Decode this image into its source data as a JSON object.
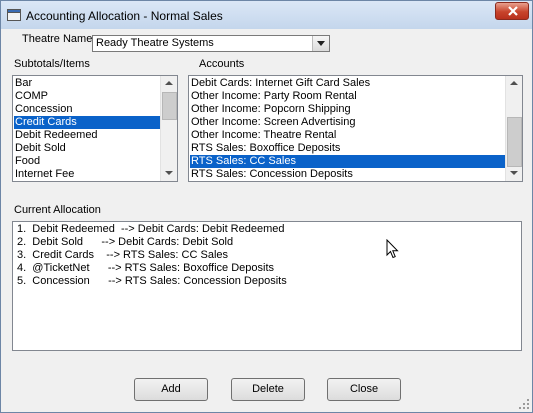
{
  "window": {
    "title": "Accounting Allocation - Normal Sales"
  },
  "theatre": {
    "label": "Theatre Name",
    "selected": "Ready Theatre Systems"
  },
  "subtotals": {
    "label": "Subtotals/Items",
    "items": [
      "Bar",
      "COMP",
      "Concession",
      "Credit Cards",
      "Debit Redeemed",
      "Debit Sold",
      "Food",
      "Internet Fee"
    ],
    "selected_index": 3
  },
  "accounts": {
    "label": "Accounts",
    "items": [
      "Debit Cards: Internet Gift Card Sales",
      "Other Income: Party Room Rental",
      "Other Income: Popcorn Shipping",
      "Other Income: Screen Advertising",
      "Other Income: Theatre Rental",
      "RTS Sales: Boxoffice Deposits",
      "RTS Sales: CC Sales",
      "RTS Sales: Concession Deposits"
    ],
    "selected_index": 6
  },
  "current_allocation": {
    "label": "Current Allocation",
    "lines": [
      "1.  Debit Redeemed  --> Debit Cards: Debit Redeemed",
      "2.  Debit Sold      --> Debit Cards: Debit Sold",
      "3.  Credit Cards    --> RTS Sales: CC Sales",
      "4.  @TicketNet      --> RTS Sales: Boxoffice Deposits",
      "5.  Concession      --> RTS Sales: Concession Deposits"
    ]
  },
  "buttons": {
    "add": "Add",
    "delete": "Delete",
    "close": "Close"
  },
  "colors": {
    "selection": "#0a62c9",
    "window_bg": "#f0f0f0",
    "titlebar": "#c4d6ec",
    "close": "#c8442c"
  },
  "icons": {
    "app": "app-icon",
    "close": "close-icon",
    "cursor": "mouse-pointer-icon",
    "grip": "size-grip-icon"
  }
}
